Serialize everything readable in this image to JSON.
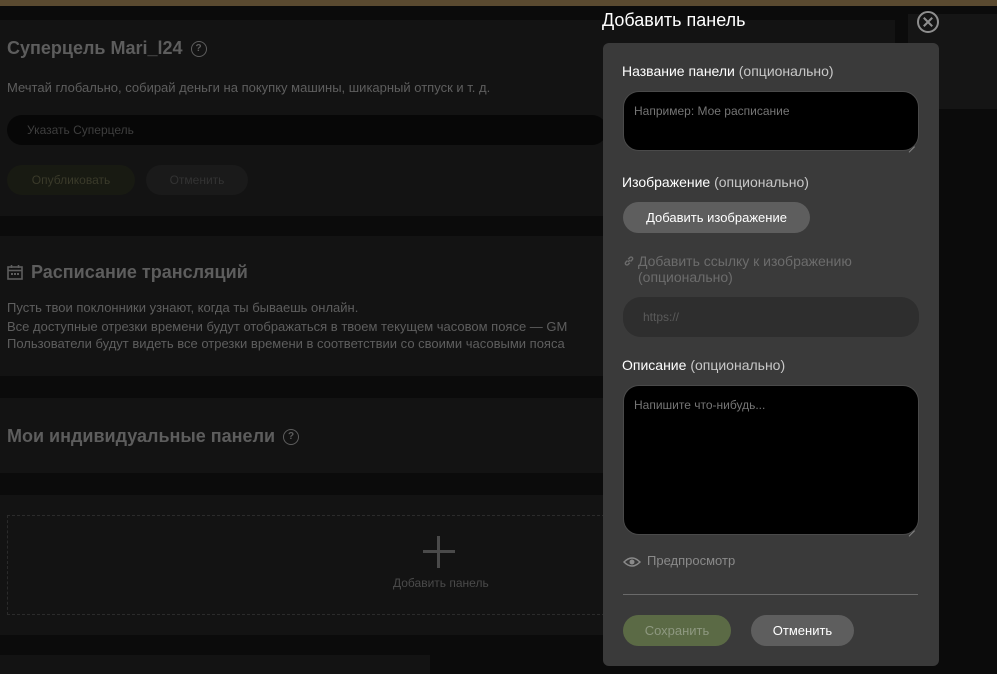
{
  "background": {
    "supergoal": {
      "title": "Суперцель Mari_l24",
      "description": "Мечтай глобально, собирай деньги на покупку машины, шикарный отпуск и т. д.",
      "input_placeholder": "Указать Суперцель",
      "publish_label": "Опубликовать",
      "cancel_label": "Отменить"
    },
    "schedule": {
      "title": "Расписание трансляций",
      "lines": [
        "Пусть твои поклонники узнают, когда ты бываешь онлайн.",
        "Все доступные отрезки времени будут отображаться в твоем текущем часовом поясе — GM",
        "Пользователи будут видеть все отрезки времени в соответствии со своими часовыми пояса"
      ]
    },
    "panels": {
      "title": "Мои индивидуальные панели",
      "add_label": "Добавить панель"
    }
  },
  "modal": {
    "title": "Добавить панель",
    "name": {
      "label": "Название панели",
      "optional": "(опционально)",
      "placeholder": "Например: Мое расписание"
    },
    "image": {
      "label": "Изображение",
      "optional": "(опционально)",
      "button": "Добавить изображение"
    },
    "image_link": {
      "label_line1": "Добавить ссылку к изображению",
      "label_line2": "(опционально)",
      "placeholder": "https://"
    },
    "description": {
      "label": "Описание",
      "optional": "(опционально)",
      "placeholder": "Напишите что-нибудь..."
    },
    "preview_label": "Предпросмотр",
    "save_label": "Сохранить",
    "cancel_label": "Отменить"
  },
  "colors": {
    "accent_save": "#5b6a45",
    "modal_bg": "#3a3a3a",
    "button_gray": "#5e5e5e"
  }
}
